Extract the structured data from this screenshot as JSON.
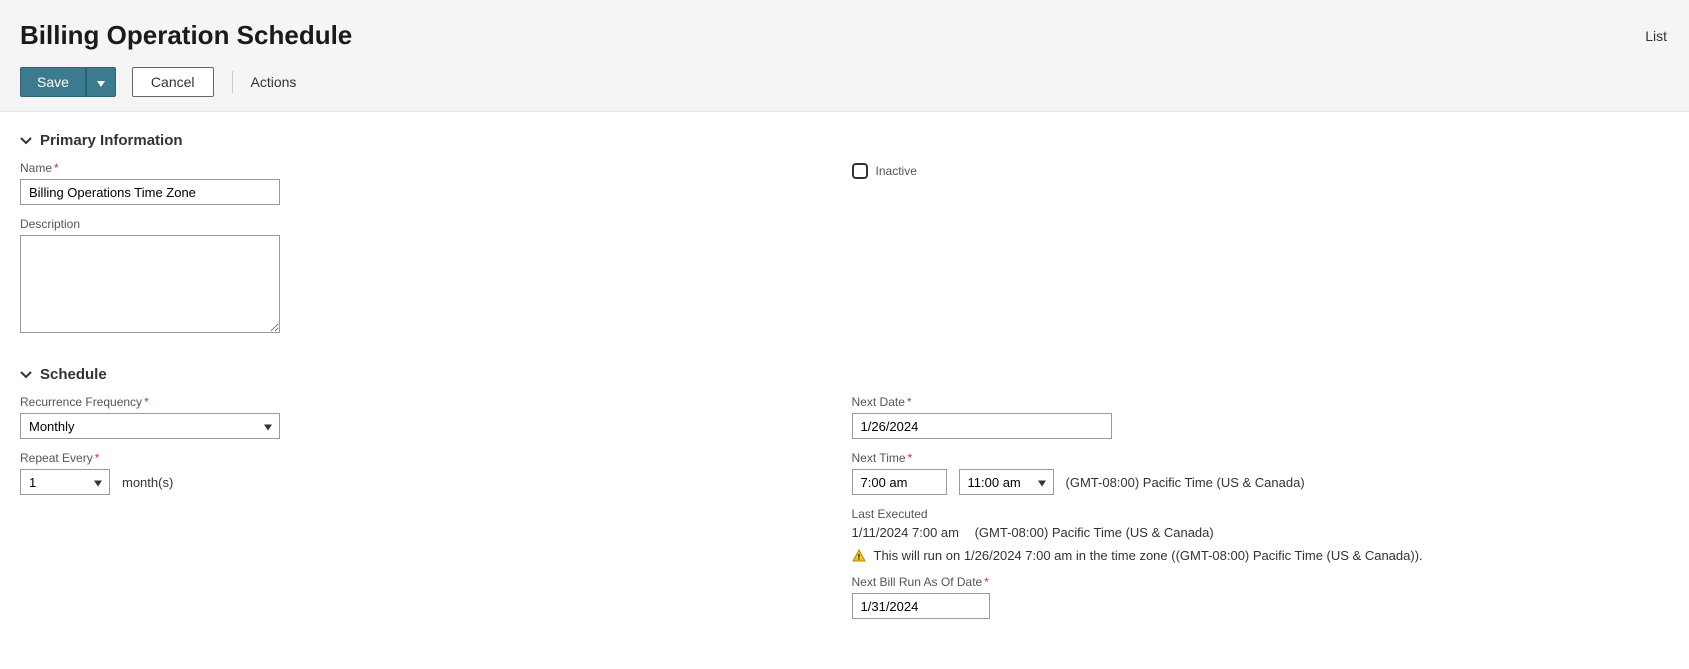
{
  "header": {
    "title": "Billing Operation Schedule",
    "list_label": "List"
  },
  "toolbar": {
    "save_label": "Save",
    "cancel_label": "Cancel",
    "actions_label": "Actions"
  },
  "sections": {
    "primary_info": "Primary Information",
    "schedule": "Schedule"
  },
  "fields": {
    "name_label": "Name",
    "name_value": "Billing Operations Time Zone",
    "description_label": "Description",
    "description_value": "",
    "inactive_label": "Inactive",
    "inactive_checked": false,
    "recurrence_label": "Recurrence Frequency",
    "recurrence_value": "Monthly",
    "repeat_label": "Repeat Every",
    "repeat_value": "1",
    "repeat_unit": "month(s)",
    "next_date_label": "Next Date",
    "next_date_value": "1/26/2024",
    "next_time_label": "Next Time",
    "next_time_value": "7:00 am",
    "next_time_select_value": "11:00 am",
    "timezone": "(GMT-08:00) Pacific Time (US & Canada)",
    "last_executed_label": "Last Executed",
    "last_executed_value": "1/11/2024 7:00 am",
    "last_executed_tz": "(GMT-08:00) Pacific Time (US & Canada)",
    "warning_text": "This will run on 1/26/2024 7:00 am in the time zone ((GMT-08:00) Pacific Time (US & Canada)).",
    "next_bill_label": "Next Bill Run As Of Date",
    "next_bill_value": "1/31/2024"
  }
}
